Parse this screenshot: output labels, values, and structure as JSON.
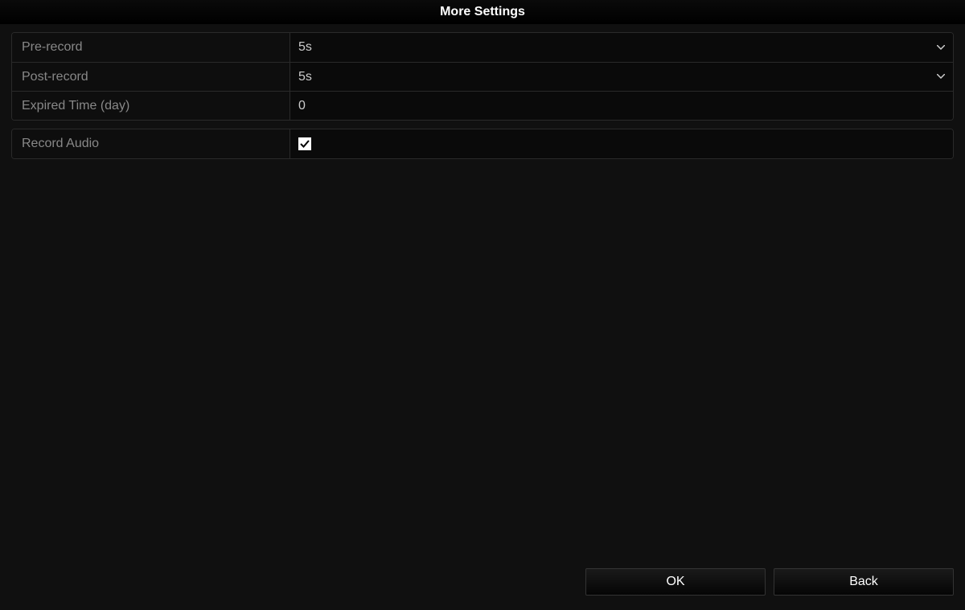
{
  "title": "More Settings",
  "form": {
    "pre_record": {
      "label": "Pre-record",
      "value": "5s"
    },
    "post_record": {
      "label": "Post-record",
      "value": "5s"
    },
    "expired_time": {
      "label": "Expired Time (day)",
      "value": "0"
    },
    "record_audio": {
      "label": "Record Audio",
      "checked": true
    }
  },
  "footer": {
    "ok": "OK",
    "back": "Back"
  }
}
